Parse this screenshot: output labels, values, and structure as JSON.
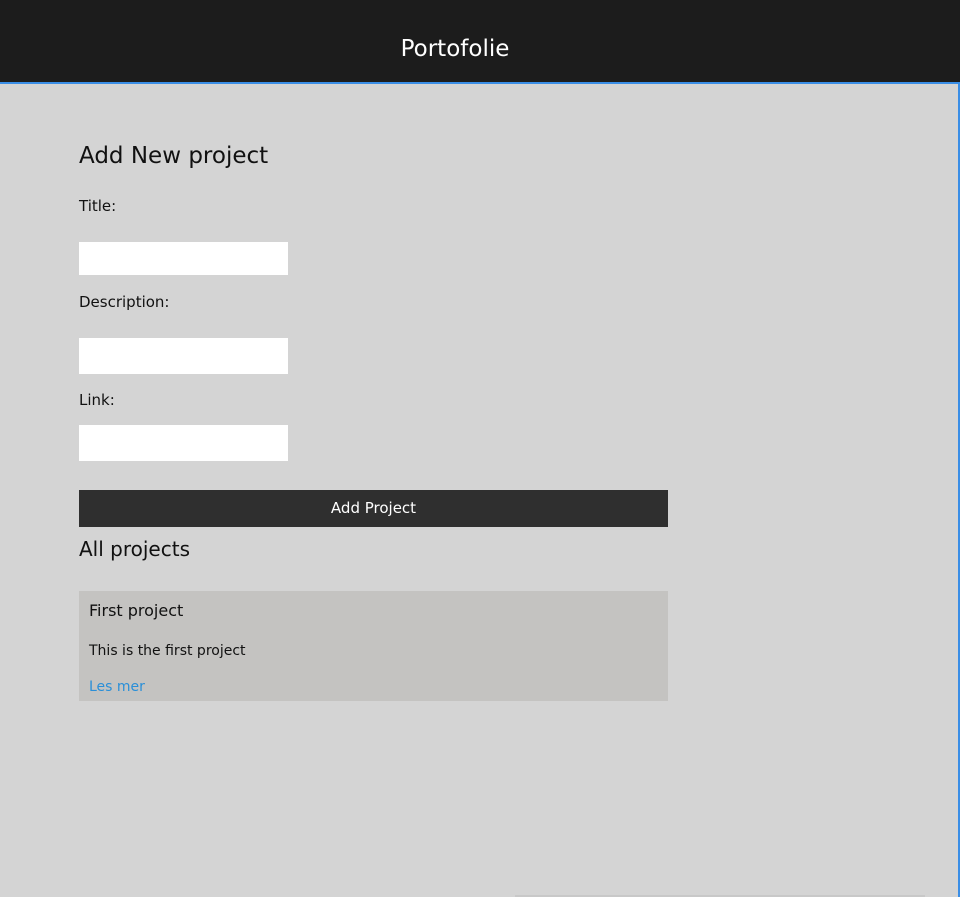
{
  "header": {
    "title": "Portofolie"
  },
  "form": {
    "title": "Add New project",
    "fields": [
      {
        "label": "Title:",
        "value": "",
        "placeholder": ""
      },
      {
        "label": "Description:",
        "value": "",
        "placeholder": ""
      },
      {
        "label": "Link:",
        "value": "",
        "placeholder": ""
      }
    ],
    "submit_label": "Add Project"
  },
  "projects": {
    "title": "All projects",
    "items": [
      {
        "title": "First project",
        "description": "This is the first project",
        "link_label": "Les mer"
      }
    ]
  },
  "colors": {
    "header_bg": "#1c1c1c",
    "page_bg": "#d4d4d4",
    "accent_border": "#3a8ee6",
    "button_bg": "#2f2f2f",
    "card_bg": "#c4c3c1",
    "link": "#2a8fd8"
  }
}
